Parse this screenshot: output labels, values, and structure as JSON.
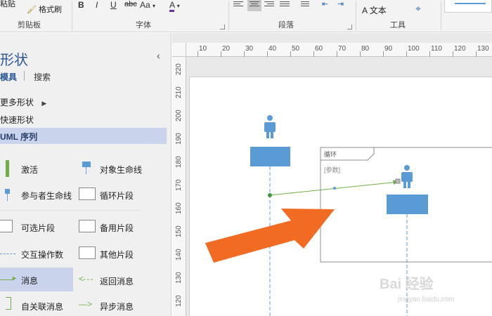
{
  "ribbon": {
    "clipboard": {
      "paste_label": "粘贴",
      "format_painter_label": "格式刷",
      "group_label": "剪贴板"
    },
    "font": {
      "bold": "B",
      "italic": "I",
      "underline": "U",
      "strike": "abc",
      "size_label": "Aa",
      "color_label": "A",
      "group_label": "字体"
    },
    "paragraph": {
      "group_label": "段落"
    },
    "tools": {
      "text_label": "文本",
      "text_glyph": "A",
      "group_label": "工具"
    }
  },
  "shapes_panel": {
    "title": "形状",
    "tabs": [
      "模具",
      "搜索"
    ],
    "collapse_glyph": "‹",
    "nav": [
      "更多形状",
      "快速形状",
      "UML 序列"
    ],
    "items": [
      {
        "label": "激活",
        "icon": "activation-icon"
      },
      {
        "label": "对象生命线",
        "icon": "object-lifeline-icon"
      },
      {
        "label": "参与者生命线",
        "icon": "actor-lifeline-icon"
      },
      {
        "label": "循环片段",
        "icon": "fragment-icon"
      },
      {
        "label": "可选片段",
        "icon": "fragment-icon"
      },
      {
        "label": "备用片段",
        "icon": "fragment-icon"
      },
      {
        "label": "交互操作数",
        "icon": "dashed-line-icon"
      },
      {
        "label": "其他片段",
        "icon": "fragment-icon"
      },
      {
        "label": "消息",
        "icon": "message-arrow-icon"
      },
      {
        "label": "返回消息",
        "icon": "return-message-icon"
      },
      {
        "label": "自关联消息",
        "icon": "self-message-icon"
      },
      {
        "label": "异步消息",
        "icon": "async-message-icon"
      }
    ]
  },
  "canvas": {
    "hruler_ticks": [
      "10",
      "20",
      "30",
      "40",
      "50",
      "60",
      "70",
      "80",
      "90",
      "100",
      "110",
      "120",
      "130"
    ],
    "vruler_ticks": [
      "220",
      "210",
      "200",
      "190",
      "180",
      "170",
      "160",
      "150",
      "140",
      "130",
      "120"
    ],
    "loop_fragment": {
      "title": "循环",
      "guard": "[参数]"
    },
    "colors": {
      "lifeline": "#5b9bd5",
      "message": "#70ad47",
      "arrow": "#f26b22"
    }
  },
  "watermark": {
    "brand": "Bai 经验",
    "url": "jingyan.baidu.com"
  }
}
